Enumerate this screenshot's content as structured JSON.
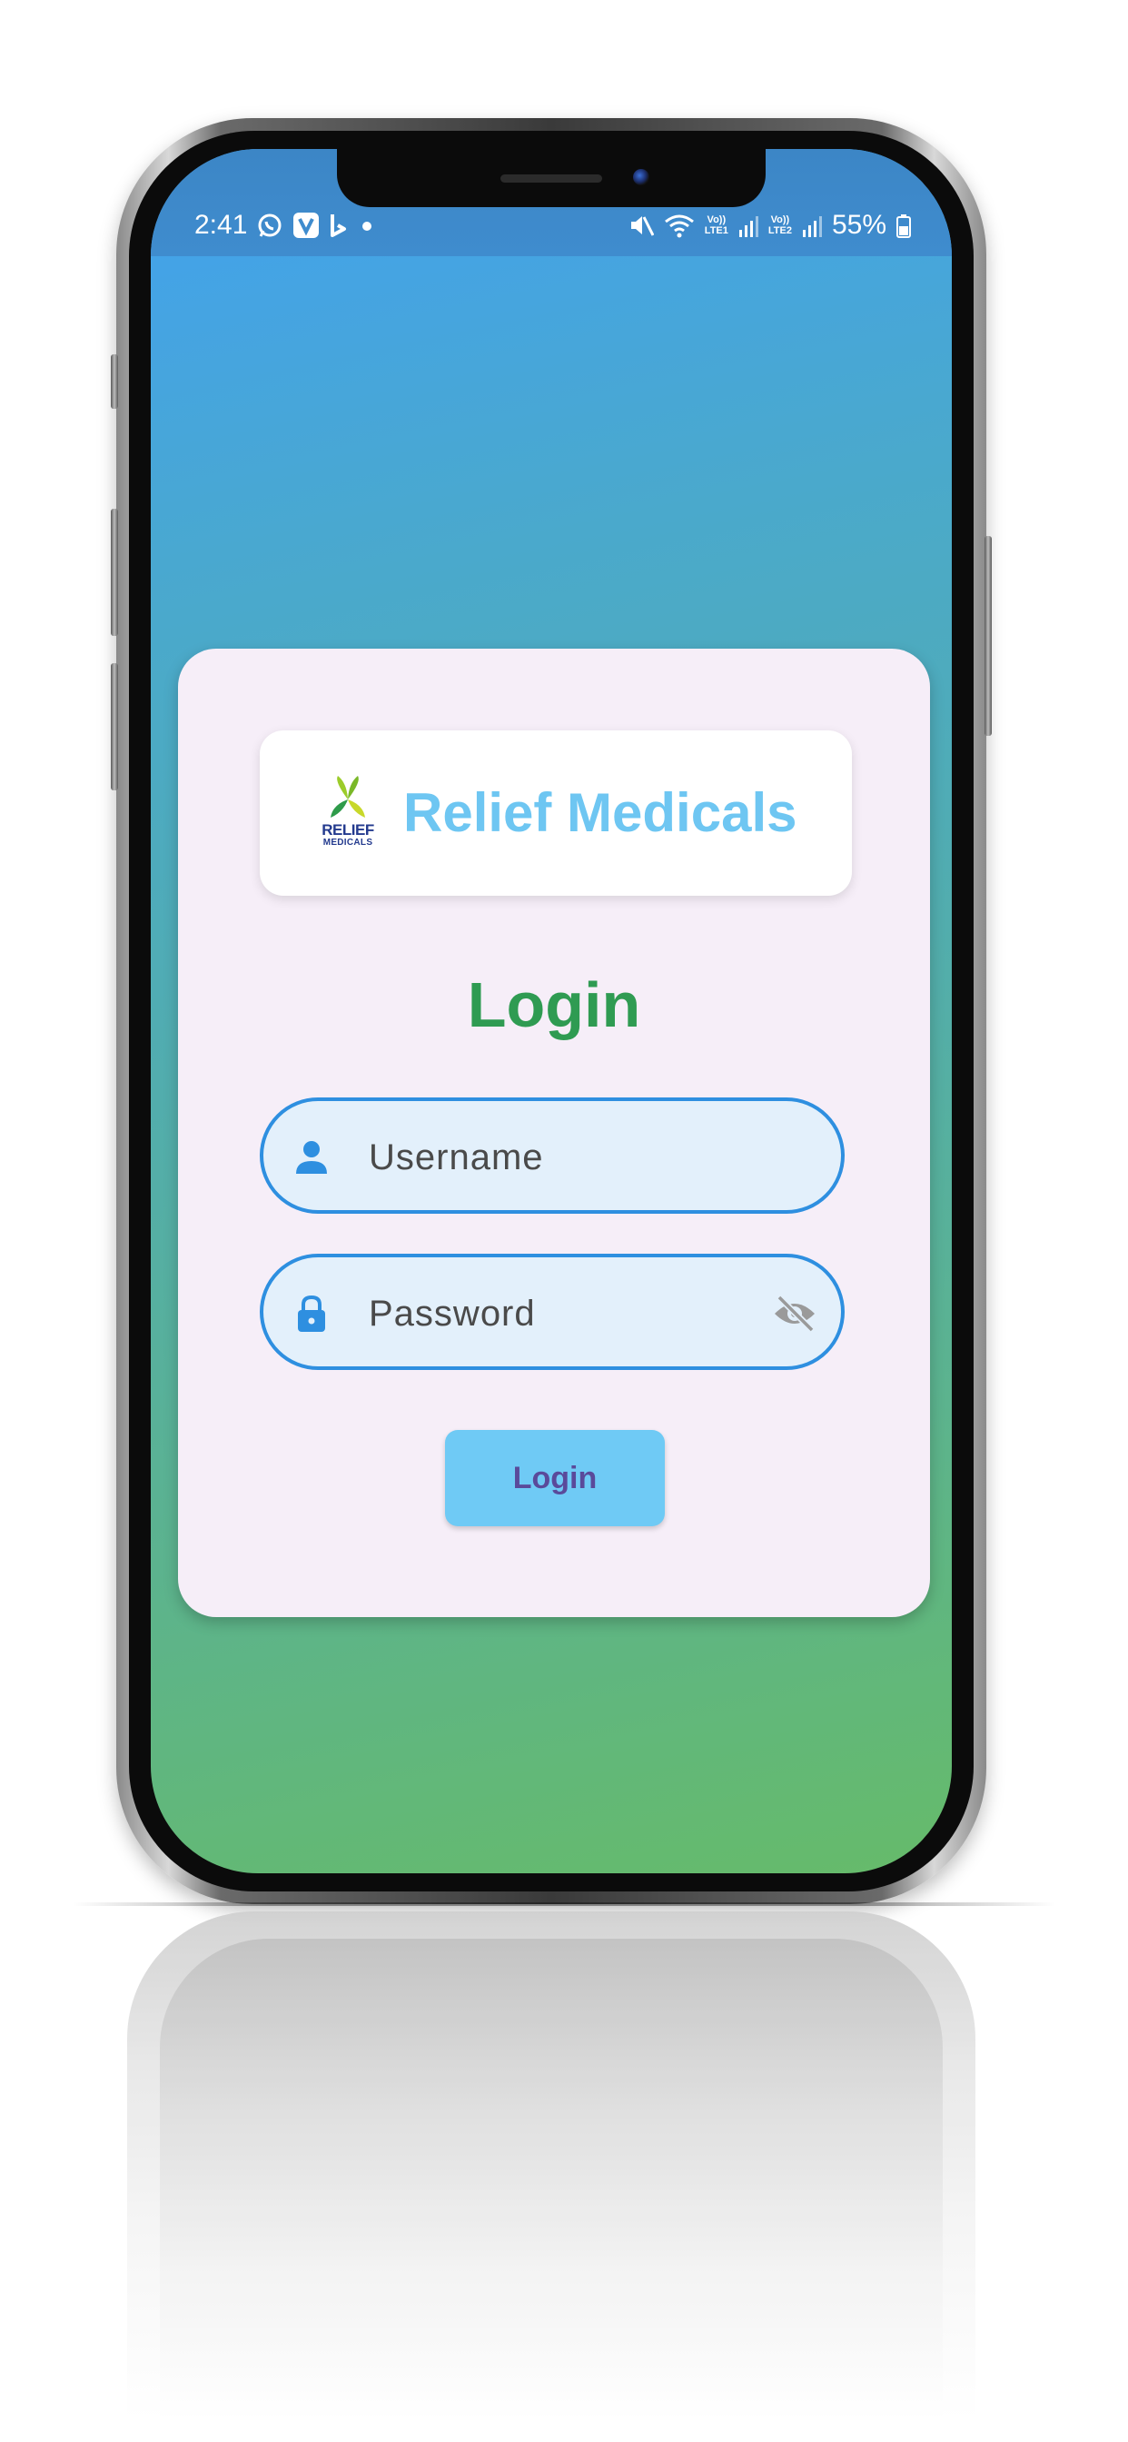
{
  "status_bar": {
    "time": "2:41",
    "battery": "55%",
    "net1_top": "Vo))",
    "net1_bottom": "LTE1",
    "net2_top": "Vo))",
    "net2_bottom": "LTE2",
    "icons": [
      "whatsapp-icon",
      "v-app-icon",
      "bing-icon",
      "notification-dot-icon",
      "mute-icon",
      "wifi-icon",
      "signal-icon",
      "signal-icon",
      "battery-icon"
    ]
  },
  "brand": {
    "logo_line1": "RELIEF",
    "logo_line2": "MEDICALS",
    "name": "Relief Medicals"
  },
  "login": {
    "title": "Login",
    "username_placeholder": "Username",
    "password_placeholder": "Password",
    "button_label": "Login"
  },
  "colors": {
    "gradient_top": "#42a1ef",
    "gradient_bottom": "#66bb6a",
    "card_bg": "#f6eef8",
    "brand_text": "#6ec6f2",
    "title_green": "#2f9b52",
    "field_border": "#2e8fe0",
    "field_bg": "#e3f0fb",
    "button_bg": "#6fcaf5",
    "button_text": "#5a4a9a"
  }
}
